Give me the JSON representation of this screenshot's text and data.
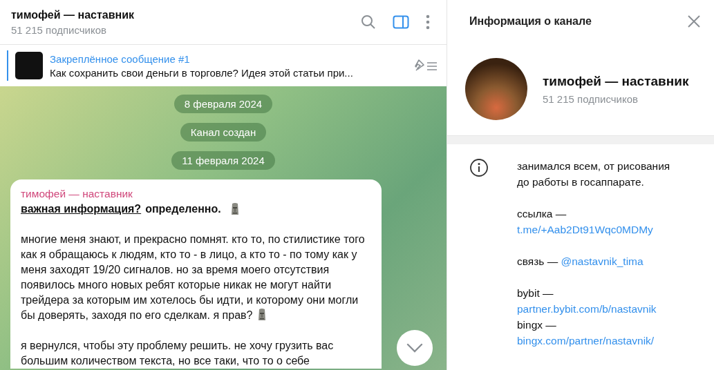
{
  "chat_header": {
    "title": "тимофей — наставник",
    "subtitle": "51 215 подписчиков",
    "side_panel_open": true
  },
  "pinned": {
    "title": "Закреплённое сообщение #1",
    "text": "Как сохранить свои деньги в торговле?  Идея этой статьи при..."
  },
  "service_messages": [
    {
      "text": "8 февраля 2024"
    },
    {
      "text": "Канал создан"
    },
    {
      "text": "11 февраля 2024"
    }
  ],
  "message": {
    "author": "тимофей — наставник",
    "title_link": "важная информация?",
    "title_rest": " определенно.",
    "title_emoji": true,
    "paragraphs": [
      {
        "text": "многие меня знают, и прекрасно помнят. кто то, по стилистике того как я обращаюсь к людям, кто то - в лицо, а кто то - по тому как у меня заходят 19/20 сигналов. но за время моего отсутствия появилось много новых ребят которые никак не могут найти трейдера за которым им хотелось бы идти, и которому они могли бы доверять, заходя по его сделкам. я прав?",
        "emoji": true
      },
      {
        "text": "я вернулся, чтобы эту проблему решить. не хочу грузить вас большим количеством текста, но все таки, что то о себе",
        "emoji": false
      }
    ]
  },
  "info_panel": {
    "title": "Информация о канале",
    "name": "тимофей — наставник",
    "subtitle": "51 215 подписчиков",
    "about": "занимался всем, от рисования до работы в госаппарате.",
    "groups": [
      [
        {
          "label": "ссылка —",
          "link": "t.me/+Aab2Dt91Wqc0MDMy",
          "kind": "stacked"
        }
      ],
      [
        {
          "label": "связь —",
          "link": "@nastavnik_tima",
          "kind": "inline"
        }
      ],
      [
        {
          "label": "bybit —",
          "link": "partner.bybit.com/b/nastavnik",
          "kind": "stacked"
        },
        {
          "label": "bingx —",
          "link": "bingx.com/partner/nastavnik/",
          "kind": "stacked"
        }
      ]
    ]
  }
}
